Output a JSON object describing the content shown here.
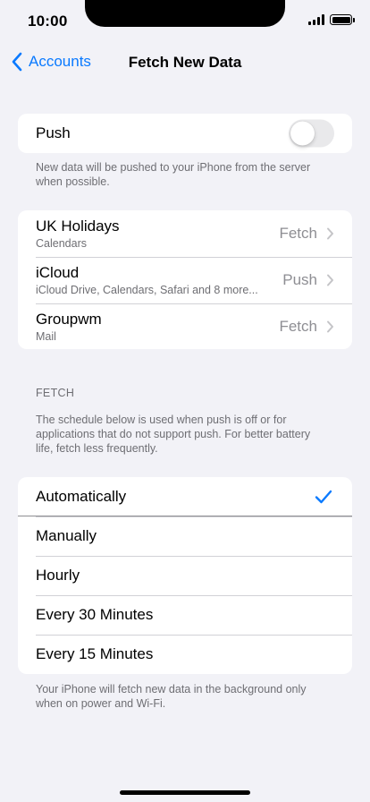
{
  "status_bar": {
    "time": "10:00"
  },
  "navbar": {
    "back_label": "Accounts",
    "title": "Fetch New Data"
  },
  "push": {
    "label": "Push",
    "enabled": false,
    "footnote": "New data will be pushed to your iPhone from the server when possible."
  },
  "accounts": [
    {
      "name": "UK Holidays",
      "services": "Calendars",
      "mode": "Fetch"
    },
    {
      "name": "iCloud",
      "services": "iCloud Drive, Calendars, Safari and 8 more...",
      "mode": "Push"
    },
    {
      "name": "Groupwm",
      "services": "Mail",
      "mode": "Fetch"
    }
  ],
  "fetch": {
    "header": "FETCH",
    "description": "The schedule below is used when push is off or for applications that do not support push. For better battery life, fetch less frequently.",
    "options": [
      {
        "label": "Automatically",
        "selected": true
      },
      {
        "label": "Manually",
        "selected": false
      },
      {
        "label": "Hourly",
        "selected": false
      },
      {
        "label": "Every 30 Minutes",
        "selected": false
      },
      {
        "label": "Every 15 Minutes",
        "selected": false
      }
    ],
    "footnote": "Your iPhone will fetch new data in the background only when on power and Wi-Fi."
  },
  "colors": {
    "accent": "#0a7aff",
    "background": "#f2f2f7",
    "secondary_text": "#6e6e73"
  }
}
